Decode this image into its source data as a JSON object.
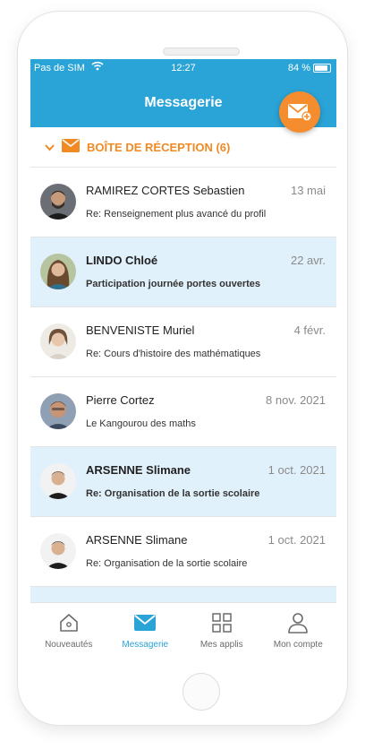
{
  "status_bar": {
    "carrier": "Pas de SIM",
    "time": "12:27",
    "battery": "84 %"
  },
  "header": {
    "title": "Messagerie"
  },
  "inbox": {
    "label": "BOÎTE DE RÉCEPTION (6)"
  },
  "messages": [
    {
      "sender": "RAMIREZ CORTES Sebastien",
      "date": "13 mai",
      "subject": "Re: Renseignement plus avancé du profil",
      "unread": false
    },
    {
      "sender": "LINDO Chloé",
      "date": "22 avr.",
      "subject": "Participation journée portes ouvertes",
      "unread": true
    },
    {
      "sender": "BENVENISTE Muriel",
      "date": "4 févr.",
      "subject": "Re: Cours d'histoire des mathématiques",
      "unread": false
    },
    {
      "sender": "Pierre Cortez",
      "date": "8 nov. 2021",
      "subject": "Le Kangourou des maths",
      "unread": false
    },
    {
      "sender": "ARSENNE Slimane",
      "date": "1 oct. 2021",
      "subject": "Re: Organisation de la sortie scolaire",
      "unread": true
    },
    {
      "sender": "ARSENNE Slimane",
      "date": "1 oct. 2021",
      "subject": "Re: Organisation de la sortie scolaire",
      "unread": false
    }
  ],
  "tabs": [
    {
      "label": "Nouveautés",
      "icon": "home-icon",
      "active": false
    },
    {
      "label": "Messagerie",
      "icon": "mail-icon",
      "active": true
    },
    {
      "label": "Mes applis",
      "icon": "apps-grid-icon",
      "active": false
    },
    {
      "label": "Mon compte",
      "icon": "user-icon",
      "active": false
    }
  ],
  "colors": {
    "primary": "#2aa3d6",
    "accent": "#f58d2f",
    "unread_bg": "#e1f1fb"
  }
}
